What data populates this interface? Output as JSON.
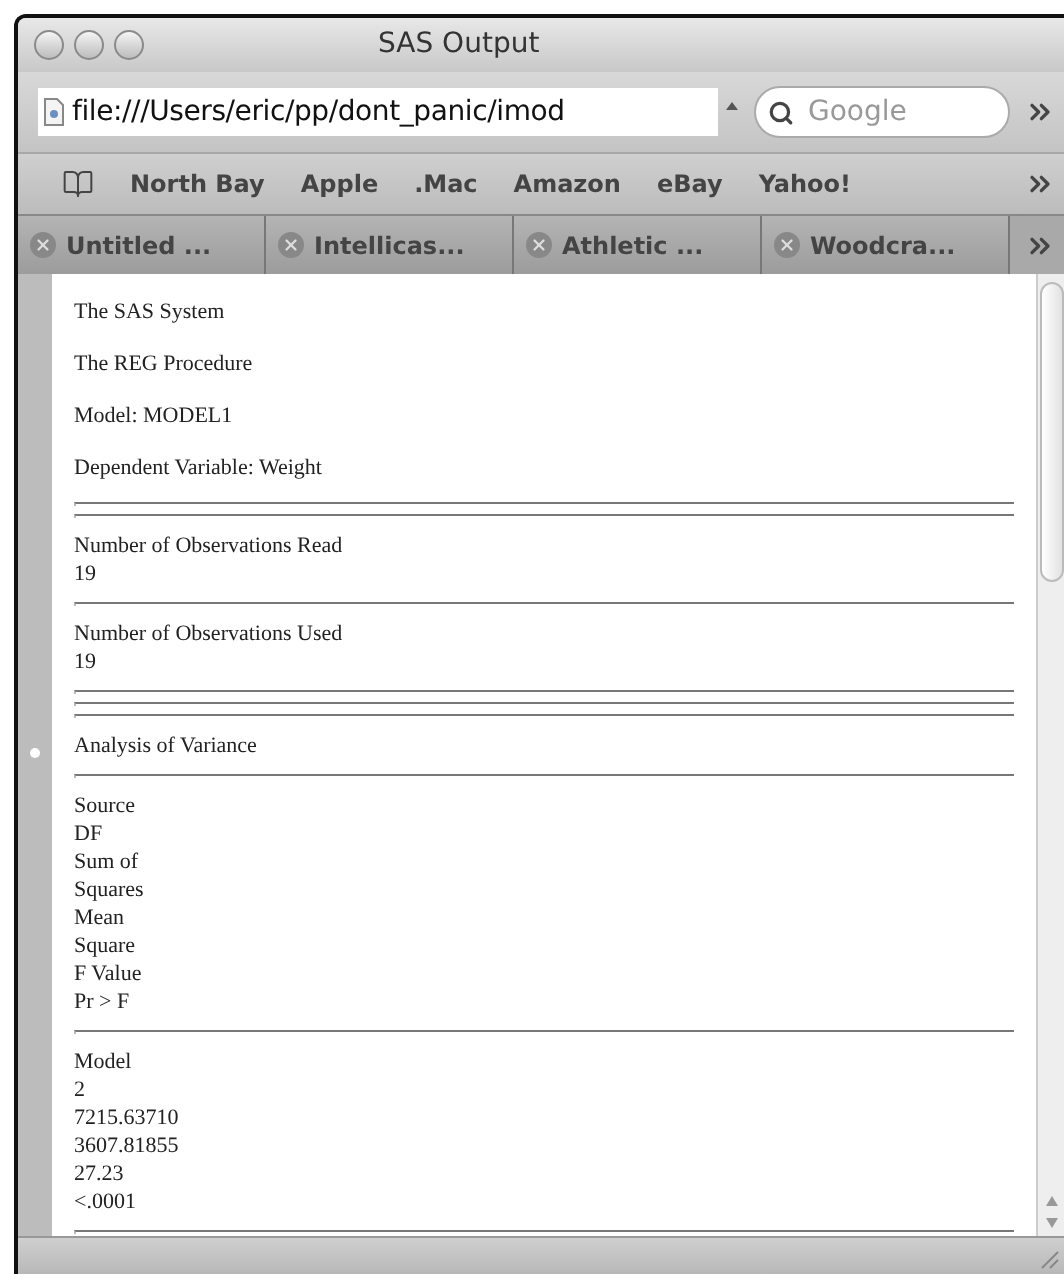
{
  "window": {
    "title": "SAS Output"
  },
  "address_bar": {
    "value": "file:///Users/eric/pp/dont_panic/imod"
  },
  "search": {
    "placeholder": "Google"
  },
  "bookmarks": [
    "North Bay",
    "Apple",
    ".Mac",
    "Amazon",
    "eBay",
    "Yahoo!"
  ],
  "tabs": [
    {
      "label": "Untitled ...",
      "selected": false
    },
    {
      "label": "Intellicas...",
      "selected": false
    },
    {
      "label": "Athletic ...",
      "selected": false
    },
    {
      "label": "Woodcra...",
      "selected": false
    }
  ],
  "content": [
    {
      "kind": "para",
      "lines": [
        "The SAS System"
      ]
    },
    {
      "kind": "para",
      "lines": [
        "The REG Procedure"
      ]
    },
    {
      "kind": "para",
      "lines": [
        "Model: MODEL1"
      ]
    },
    {
      "kind": "para",
      "lines": [
        "Dependent Variable: Weight"
      ]
    },
    {
      "kind": "rule"
    },
    {
      "kind": "rule"
    },
    {
      "kind": "cell",
      "lines": [
        "Number of Observations Read",
        "19"
      ]
    },
    {
      "kind": "rule"
    },
    {
      "kind": "cell",
      "lines": [
        "Number of Observations Used",
        "19"
      ]
    },
    {
      "kind": "rule"
    },
    {
      "kind": "rule"
    },
    {
      "kind": "rule"
    },
    {
      "kind": "cell",
      "lines": [
        "Analysis of Variance"
      ]
    },
    {
      "kind": "rule"
    },
    {
      "kind": "cell",
      "lines": [
        "Source",
        "DF",
        "Sum of",
        "Squares",
        "Mean",
        "Square",
        "F Value",
        "Pr > F"
      ]
    },
    {
      "kind": "rule"
    },
    {
      "kind": "cell",
      "lines": [
        "Model",
        "2",
        "7215.63710",
        "3607.81855",
        "27.23",
        "<.0001"
      ]
    },
    {
      "kind": "rule"
    }
  ]
}
